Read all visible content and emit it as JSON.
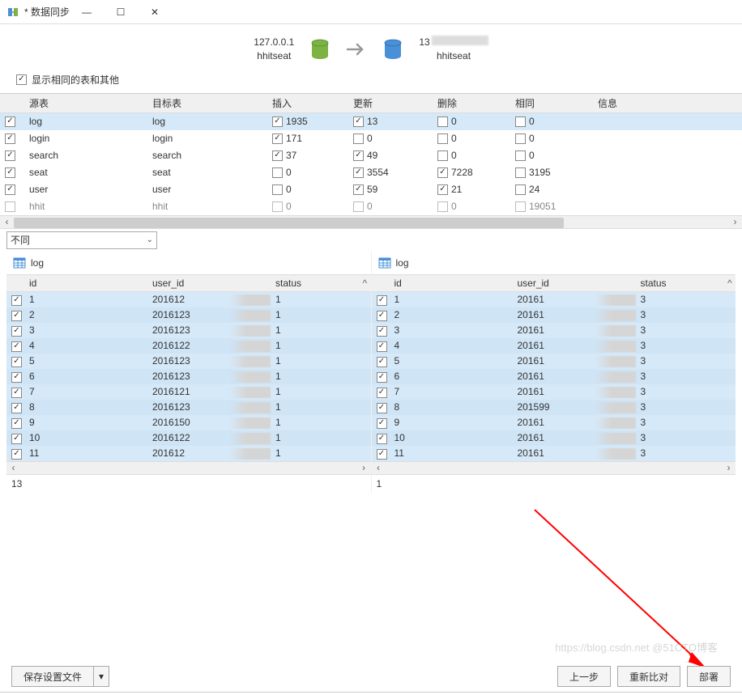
{
  "window": {
    "title": "* 数据同步",
    "minimize": "—",
    "maximize": "☐",
    "close": "✕"
  },
  "connection": {
    "source_host": "127.0.0.1",
    "source_db": "hhitseat",
    "target_host": "13",
    "target_db": "hhitseat"
  },
  "showSame": {
    "label": "显示相同的表和其他"
  },
  "topHeaders": {
    "source": "源表",
    "target": "目标表",
    "insert": "插入",
    "update": "更新",
    "delete": "删除",
    "same": "相同",
    "info": "信息"
  },
  "topRows": [
    {
      "checked": true,
      "selected": true,
      "src": "log",
      "tgt": "log",
      "ins": "1935",
      "insChk": true,
      "upd": "13",
      "updChk": true,
      "del": "0",
      "delChk": false,
      "same": "0"
    },
    {
      "checked": true,
      "src": "login",
      "tgt": "login",
      "ins": "171",
      "insChk": true,
      "upd": "0",
      "updChk": false,
      "del": "0",
      "delChk": false,
      "same": "0"
    },
    {
      "checked": true,
      "src": "search",
      "tgt": "search",
      "ins": "37",
      "insChk": true,
      "upd": "49",
      "updChk": true,
      "del": "0",
      "delChk": false,
      "same": "0"
    },
    {
      "checked": true,
      "src": "seat",
      "tgt": "seat",
      "ins": "0",
      "insChk": false,
      "upd": "3554",
      "updChk": true,
      "del": "7228",
      "delChk": true,
      "same": "3195"
    },
    {
      "checked": true,
      "src": "user",
      "tgt": "user",
      "ins": "0",
      "insChk": false,
      "upd": "59",
      "updChk": true,
      "del": "21",
      "delChk": true,
      "same": "24"
    },
    {
      "checked": false,
      "disabled": true,
      "src": "hhit",
      "tgt": "hhit",
      "ins": "0",
      "insChk": false,
      "upd": "0",
      "updChk": false,
      "del": "0",
      "delChk": false,
      "same": "19051"
    }
  ],
  "filter": {
    "selected": "不同"
  },
  "panels": {
    "left": {
      "title": "log",
      "headers": {
        "id": "id",
        "user_id": "user_id",
        "status": "status"
      },
      "rows": [
        {
          "id": "1",
          "uid": "201612",
          "status": "1"
        },
        {
          "id": "2",
          "uid": "2016123",
          "status": "1"
        },
        {
          "id": "3",
          "uid": "2016123",
          "status": "1"
        },
        {
          "id": "4",
          "uid": "2016122",
          "status": "1"
        },
        {
          "id": "5",
          "uid": "2016123",
          "status": "1"
        },
        {
          "id": "6",
          "uid": "2016123",
          "status": "1"
        },
        {
          "id": "7",
          "uid": "2016121",
          "status": "1"
        },
        {
          "id": "8",
          "uid": "2016123",
          "status": "1"
        },
        {
          "id": "9",
          "uid": "2016150",
          "status": "1"
        },
        {
          "id": "10",
          "uid": "2016122",
          "status": "1"
        },
        {
          "id": "11",
          "uid": "201612",
          "status": "1"
        }
      ],
      "footer": "13"
    },
    "right": {
      "title": "log",
      "headers": {
        "id": "id",
        "user_id": "user_id",
        "status": "status"
      },
      "rows": [
        {
          "id": "1",
          "uid": "20161",
          "status": "3"
        },
        {
          "id": "2",
          "uid": "20161",
          "status": "3"
        },
        {
          "id": "3",
          "uid": "20161",
          "status": "3"
        },
        {
          "id": "4",
          "uid": "20161",
          "status": "3"
        },
        {
          "id": "5",
          "uid": "20161",
          "status": "3"
        },
        {
          "id": "6",
          "uid": "20161",
          "status": "3"
        },
        {
          "id": "7",
          "uid": "20161",
          "status": "3"
        },
        {
          "id": "8",
          "uid": "201599",
          "status": "3"
        },
        {
          "id": "9",
          "uid": "20161",
          "status": "3"
        },
        {
          "id": "10",
          "uid": "20161",
          "status": "3"
        },
        {
          "id": "11",
          "uid": "20161",
          "status": "3"
        }
      ],
      "footer": "1"
    }
  },
  "buttons": {
    "save": "保存设置文件",
    "prev": "上一步",
    "recompare": "重新比对",
    "deploy": "部署"
  },
  "watermark": "https://blog.csdn.net @51CTO博客"
}
